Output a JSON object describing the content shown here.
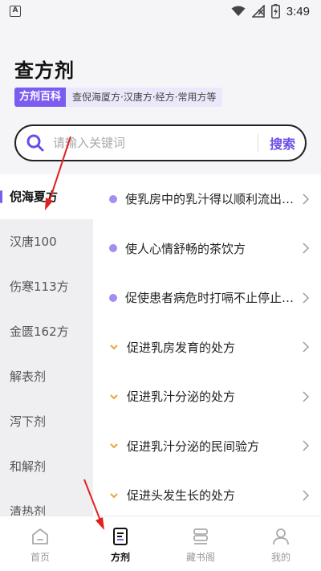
{
  "status_bar": {
    "notification_icon": "A",
    "time": "3:49",
    "icons": [
      "wifi-icon",
      "signal-off-icon",
      "battery-charging-icon"
    ]
  },
  "header": {
    "title": "查方剂",
    "badge": "方剂百科",
    "tagline": "查倪海厦方·汉唐方·经方·常用方等"
  },
  "search": {
    "placeholder": "请输入关键词",
    "button_label": "搜索"
  },
  "sidebar": {
    "items": [
      {
        "label": "倪海夏方",
        "active": true
      },
      {
        "label": "汉唐100",
        "active": false
      },
      {
        "label": "伤寒113方",
        "active": false
      },
      {
        "label": "金匮162方",
        "active": false
      },
      {
        "label": "解表剂",
        "active": false
      },
      {
        "label": "泻下剂",
        "active": false
      },
      {
        "label": "和解剂",
        "active": false
      },
      {
        "label": "清热剂",
        "active": false
      }
    ]
  },
  "list": {
    "items": [
      {
        "label": "使乳房中的乳汁得以顺利流出的处方",
        "marker": "dot"
      },
      {
        "label": "使人心情舒畅的茶饮方",
        "marker": "dot"
      },
      {
        "label": "促使患者病危时打嗝不止停止的处方",
        "marker": "dot"
      },
      {
        "label": "促进乳房发育的处方",
        "marker": "chevron"
      },
      {
        "label": "促进乳汁分泌的处方",
        "marker": "chevron"
      },
      {
        "label": "促进乳汁分泌的民间验方",
        "marker": "chevron"
      },
      {
        "label": "促进头发生长的处方",
        "marker": "chevron"
      }
    ]
  },
  "tabs": [
    {
      "label": "首页",
      "icon": "home-icon",
      "active": false
    },
    {
      "label": "方剂",
      "icon": "prescription-icon",
      "active": true
    },
    {
      "label": "藏书阁",
      "icon": "bookshelf-icon",
      "active": false
    },
    {
      "label": "我的",
      "icon": "profile-icon",
      "active": false
    }
  ],
  "colors": {
    "accent": "#7b5cf0",
    "accent_light": "#ece8fb",
    "annotation_arrow": "#e02020",
    "chevron_marker": "#e8a33c"
  }
}
